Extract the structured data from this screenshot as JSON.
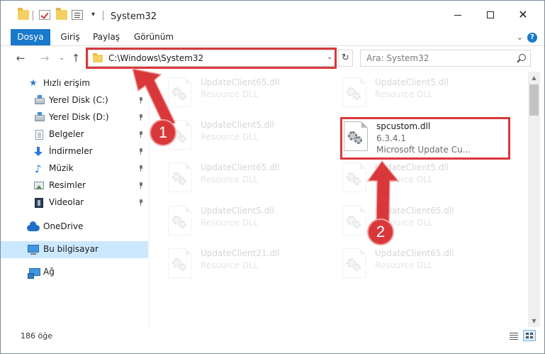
{
  "window": {
    "title": "System32"
  },
  "ribbon": {
    "tabs": [
      "Dosya",
      "Giriş",
      "Paylaş",
      "Görünüm"
    ]
  },
  "address": {
    "path": "C:\\Windows\\System32",
    "search_placeholder": "Ara: System32"
  },
  "sidebar": {
    "items": [
      {
        "label": "Hızlı erişim",
        "icon": "star-icon"
      },
      {
        "label": "Yerel Disk (C:)",
        "icon": "drive-icon",
        "pinned": true
      },
      {
        "label": "Yerel Disk (D:)",
        "icon": "drive-icon",
        "pinned": true
      },
      {
        "label": "Belgeler",
        "icon": "document-icon",
        "pinned": true
      },
      {
        "label": "İndirmeler",
        "icon": "download-icon",
        "pinned": true
      },
      {
        "label": "Müzik",
        "icon": "music-icon",
        "pinned": true
      },
      {
        "label": "Resimler",
        "icon": "pictures-icon",
        "pinned": true
      },
      {
        "label": "Videolar",
        "icon": "video-icon",
        "pinned": true
      },
      {
        "label": "OneDrive",
        "icon": "cloud-icon"
      },
      {
        "label": "Bu bilgisayar",
        "icon": "computer-icon",
        "selected": true
      },
      {
        "label": "Ağ",
        "icon": "network-icon"
      }
    ]
  },
  "files": {
    "left": [
      {
        "name": "UpdateClient65.dll",
        "type": "Resource DLL"
      },
      {
        "name": "UpdateClient5.dll",
        "type": "Resource DLL"
      },
      {
        "name": "UpdateClient65.dll",
        "type": "Resource DLL"
      },
      {
        "name": "UpdateClient5.dll",
        "type": "Resource DLL"
      },
      {
        "name": "UpdateClient21.dll",
        "type": "Resource DLL"
      }
    ],
    "right": [
      {
        "name": "UpdateClient5.dll",
        "type": "Resource DLL"
      },
      {
        "name": "UpdateClient5.dll",
        "type": "Resource DLL"
      },
      {
        "name": "UpdateClient65.dll",
        "type": "Resource DLL"
      },
      {
        "name": "UpdateClient65.dll",
        "type": "Resource DLL"
      }
    ],
    "highlighted": {
      "name": "spcustom.dll",
      "version": "6.3.4.1",
      "description": "Microsoft Update Cu..."
    }
  },
  "status": {
    "item_count": "186 öğe"
  },
  "annotations": {
    "step1": "1",
    "step2": "2",
    "color": "#d9383b"
  }
}
